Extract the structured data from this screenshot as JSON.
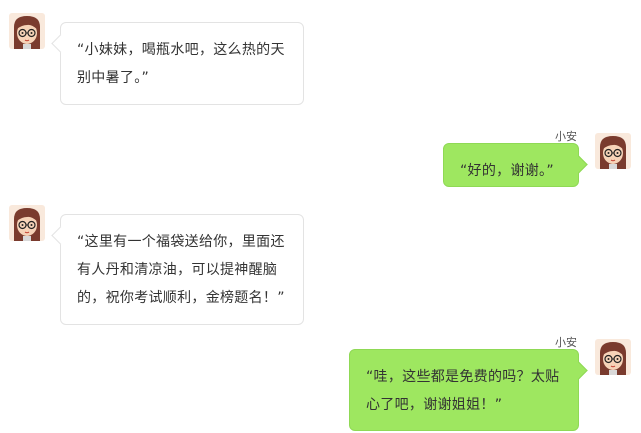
{
  "chat": {
    "messages": [
      {
        "side": "left",
        "sender": "",
        "text": "“小妹妹，喝瓶水吧，这么热的天别中暑了。”"
      },
      {
        "side": "right",
        "sender": "小安",
        "text": "“好的，谢谢。”"
      },
      {
        "side": "left",
        "sender": "",
        "text": "“这里有一个福袋送给你，里面还有人丹和清凉油，可以提神醒脑的，祝你考试顺利，金榜题名！”"
      },
      {
        "side": "right",
        "sender": "小安",
        "text": "“哇，这些都是免费的吗？太贴心了吧，谢谢姐姐！”"
      }
    ]
  },
  "colors": {
    "right_bubble": "#9ee760",
    "left_bubble": "#ffffff",
    "avatar_hair": "#7a3b2e",
    "avatar_skin": "#f6d3b8"
  }
}
